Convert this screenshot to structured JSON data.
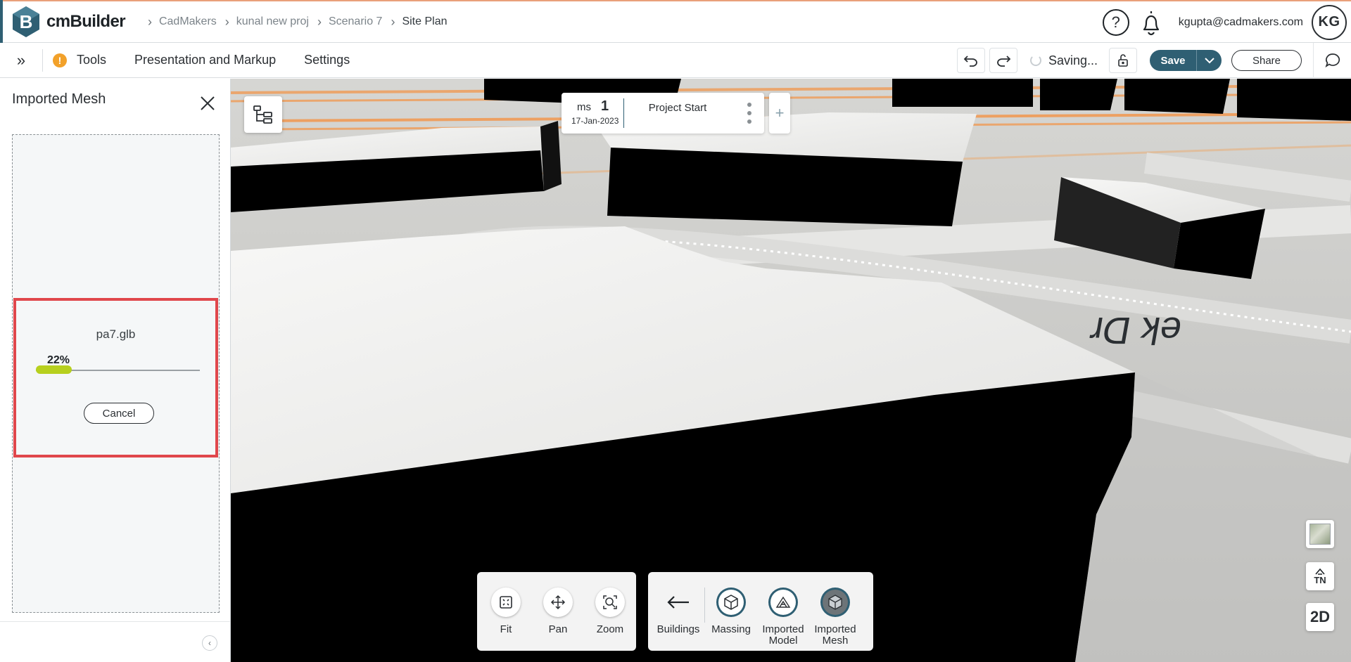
{
  "app": {
    "name": "cmBuilder",
    "logo_letter": "B"
  },
  "breadcrumb": [
    "CadMakers",
    "kunal new proj",
    "Scenario 7",
    "Site Plan"
  ],
  "header": {
    "help_glyph": "?",
    "user_email": "kgupta@cadmakers.com",
    "avatar_initials": "KG"
  },
  "toolbar": {
    "expand_glyph": "»",
    "warning_glyph": "!",
    "menu": [
      "Tools",
      "Presentation and Markup",
      "Settings"
    ],
    "saving_text": "Saving...",
    "save_label": "Save",
    "share_label": "Share"
  },
  "panel": {
    "title": "Imported Mesh",
    "upload": {
      "file_name": "pa7.glb",
      "progress_label": "22%",
      "progress": 0.22,
      "cancel_label": "Cancel"
    },
    "collapse_glyph": "‹"
  },
  "milestone": {
    "tag": "ms",
    "number": "1",
    "date": "17-Jan-2023",
    "label": "Project Start",
    "add_glyph": "+"
  },
  "view_controls": [
    {
      "label": "Fit",
      "icon": "fit-icon"
    },
    {
      "label": "Pan",
      "icon": "pan-icon"
    },
    {
      "label": "Zoom",
      "icon": "zoom-icon"
    }
  ],
  "category_controls": [
    {
      "label": "Buildings",
      "icon": "back-arrow-icon"
    },
    {
      "label": "Massing",
      "icon": "cube-icon"
    },
    {
      "label": "Imported Model",
      "icon": "imported-model-icon"
    },
    {
      "label": "Imported Mesh",
      "icon": "imported-mesh-icon"
    }
  ],
  "side_controls": {
    "north_label": "TN",
    "view_mode": "2D"
  },
  "map_text": "ek Dr",
  "colors": {
    "brand": "#2f5f73",
    "accent_orange": "#e9a07a",
    "progress": "#b7d01e",
    "highlight": "#e0474c",
    "warning": "#f2a12a"
  }
}
